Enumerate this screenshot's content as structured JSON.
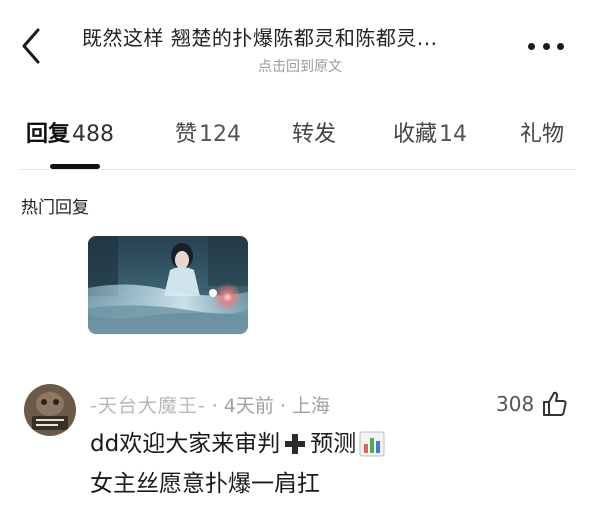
{
  "header": {
    "title": "既然这样 翘楚的扑爆陈都灵和陈都灵...",
    "subtitle": "点击回到原文",
    "back_icon": "chevron-left-icon",
    "more_icon": "more-horizontal-icon"
  },
  "tabs": [
    {
      "label": "回复",
      "count": "488",
      "active": true
    },
    {
      "label": "赞",
      "count": "124",
      "active": false
    },
    {
      "label": "转发",
      "count": "",
      "active": false
    },
    {
      "label": "收藏",
      "count": "14",
      "active": false
    },
    {
      "label": "礼物",
      "count": "",
      "active": false
    }
  ],
  "section": {
    "title": "热门回复"
  },
  "comment": {
    "username": "-天台大魔王-",
    "time": "4天前",
    "location": "上海",
    "likes": "308",
    "text_line1_a": "dd欢迎大家来审判",
    "text_line1_b": "预测",
    "text_line2": "女主丝愿意扑爆一肩扛",
    "emoji_plus": "plus-emoji-icon",
    "emoji_chart": "bar-chart-emoji-icon",
    "like_icon": "thumbs-up-icon"
  },
  "colors": {
    "text_primary": "#1a1a1a",
    "text_muted": "#9a9a9a",
    "divider": "#e6e6e6",
    "indicator": "#111111"
  }
}
